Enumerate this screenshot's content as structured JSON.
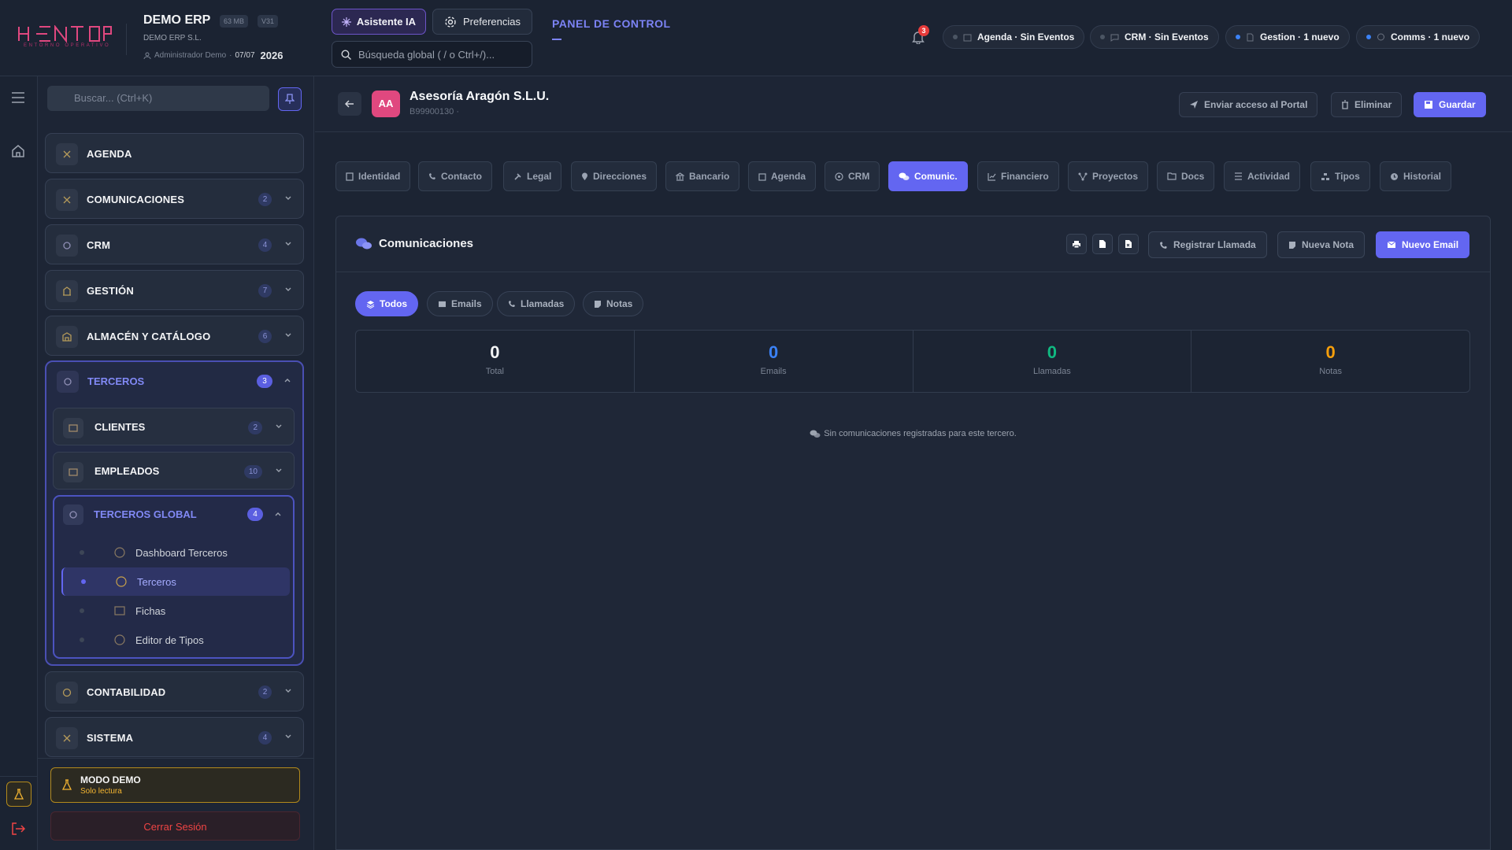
{
  "brand": {
    "logo_text": "HENTOP",
    "tagline": "ENTORNO OPERATIVO"
  },
  "app": {
    "title": "DEMO ERP",
    "size_chip": "63 MB",
    "version_chip": "V31",
    "company": "DEMO ERP S.L.",
    "user": "Administrador Demo",
    "date": "07/07",
    "year": "2026"
  },
  "header": {
    "ai_label": "Asistente IA",
    "prefs_label": "Preferencias",
    "search_placeholder": "Búsqueda global ( / o Ctrl+/)...",
    "panel_title": "PANEL DE CONTROL",
    "notif_count": "3",
    "status_pills": [
      {
        "label": "Agenda · Sin Eventos",
        "dot": "#4b5563"
      },
      {
        "label": "CRM · Sin Eventos",
        "dot": "#4b5563"
      },
      {
        "label": "Gestion · 1 nuevo",
        "dot": "#3b82f6"
      },
      {
        "label": "Comms · 1 nuevo",
        "dot": "#3b82f6"
      }
    ]
  },
  "sidebar": {
    "search_placeholder": "Buscar... (Ctrl+K)",
    "modules": [
      {
        "label": "AGENDA",
        "count": ""
      },
      {
        "label": "COMUNICACIONES",
        "count": "2"
      },
      {
        "label": "CRM",
        "count": "4"
      },
      {
        "label": "GESTIÓN",
        "count": "7"
      },
      {
        "label": "ALMACÉN Y CATÁLOGO",
        "count": "6"
      },
      {
        "label": "TERCEROS",
        "count": "3"
      },
      {
        "label": "CONTABILIDAD",
        "count": "2"
      },
      {
        "label": "SISTEMA",
        "count": "4"
      }
    ],
    "terceros_sub": [
      {
        "label": "CLIENTES",
        "count": "2"
      },
      {
        "label": "EMPLEADOS",
        "count": "10"
      },
      {
        "label": "TERCEROS GLOBAL",
        "count": "4"
      }
    ],
    "global_items": [
      "Dashboard Terceros",
      "Terceros",
      "Fichas",
      "Editor de Tipos"
    ],
    "demo_title": "MODO DEMO",
    "demo_sub": "Solo lectura",
    "logout_label": "Cerrar Sesión"
  },
  "entity": {
    "initials": "AA",
    "name": "Asesoría Aragón S.L.U.",
    "id": "B99900130 ·",
    "actions": {
      "portal": "Enviar acceso al Portal",
      "delete": "Eliminar",
      "save": "Guardar"
    }
  },
  "tabs": [
    "Identidad",
    "Contacto",
    "Legal",
    "Direcciones",
    "Bancario",
    "Agenda",
    "CRM",
    "Comunic.",
    "Financiero",
    "Proyectos",
    "Docs",
    "Actividad",
    "Tipos",
    "Historial"
  ],
  "comms": {
    "title": "Comunicaciones",
    "buttons": {
      "call": "Registrar Llamada",
      "note": "Nueva Nota",
      "email": "Nuevo Email"
    },
    "filters": [
      "Todos",
      "Emails",
      "Llamadas",
      "Notas"
    ],
    "stats": [
      {
        "value": "0",
        "label": "Total",
        "color": "#f3f4f6"
      },
      {
        "value": "0",
        "label": "Emails",
        "color": "#3b82f6"
      },
      {
        "value": "0",
        "label": "Llamadas",
        "color": "#10b981"
      },
      {
        "value": "0",
        "label": "Notas",
        "color": "#f59e0b"
      }
    ],
    "empty_message": "Sin comunicaciones registradas para este tercero."
  },
  "colors": {
    "accent": "#6366f1",
    "avatar": "#e0487f",
    "brand": "#e0487f",
    "danger": "#ef4444",
    "warning": "#f4b531"
  }
}
